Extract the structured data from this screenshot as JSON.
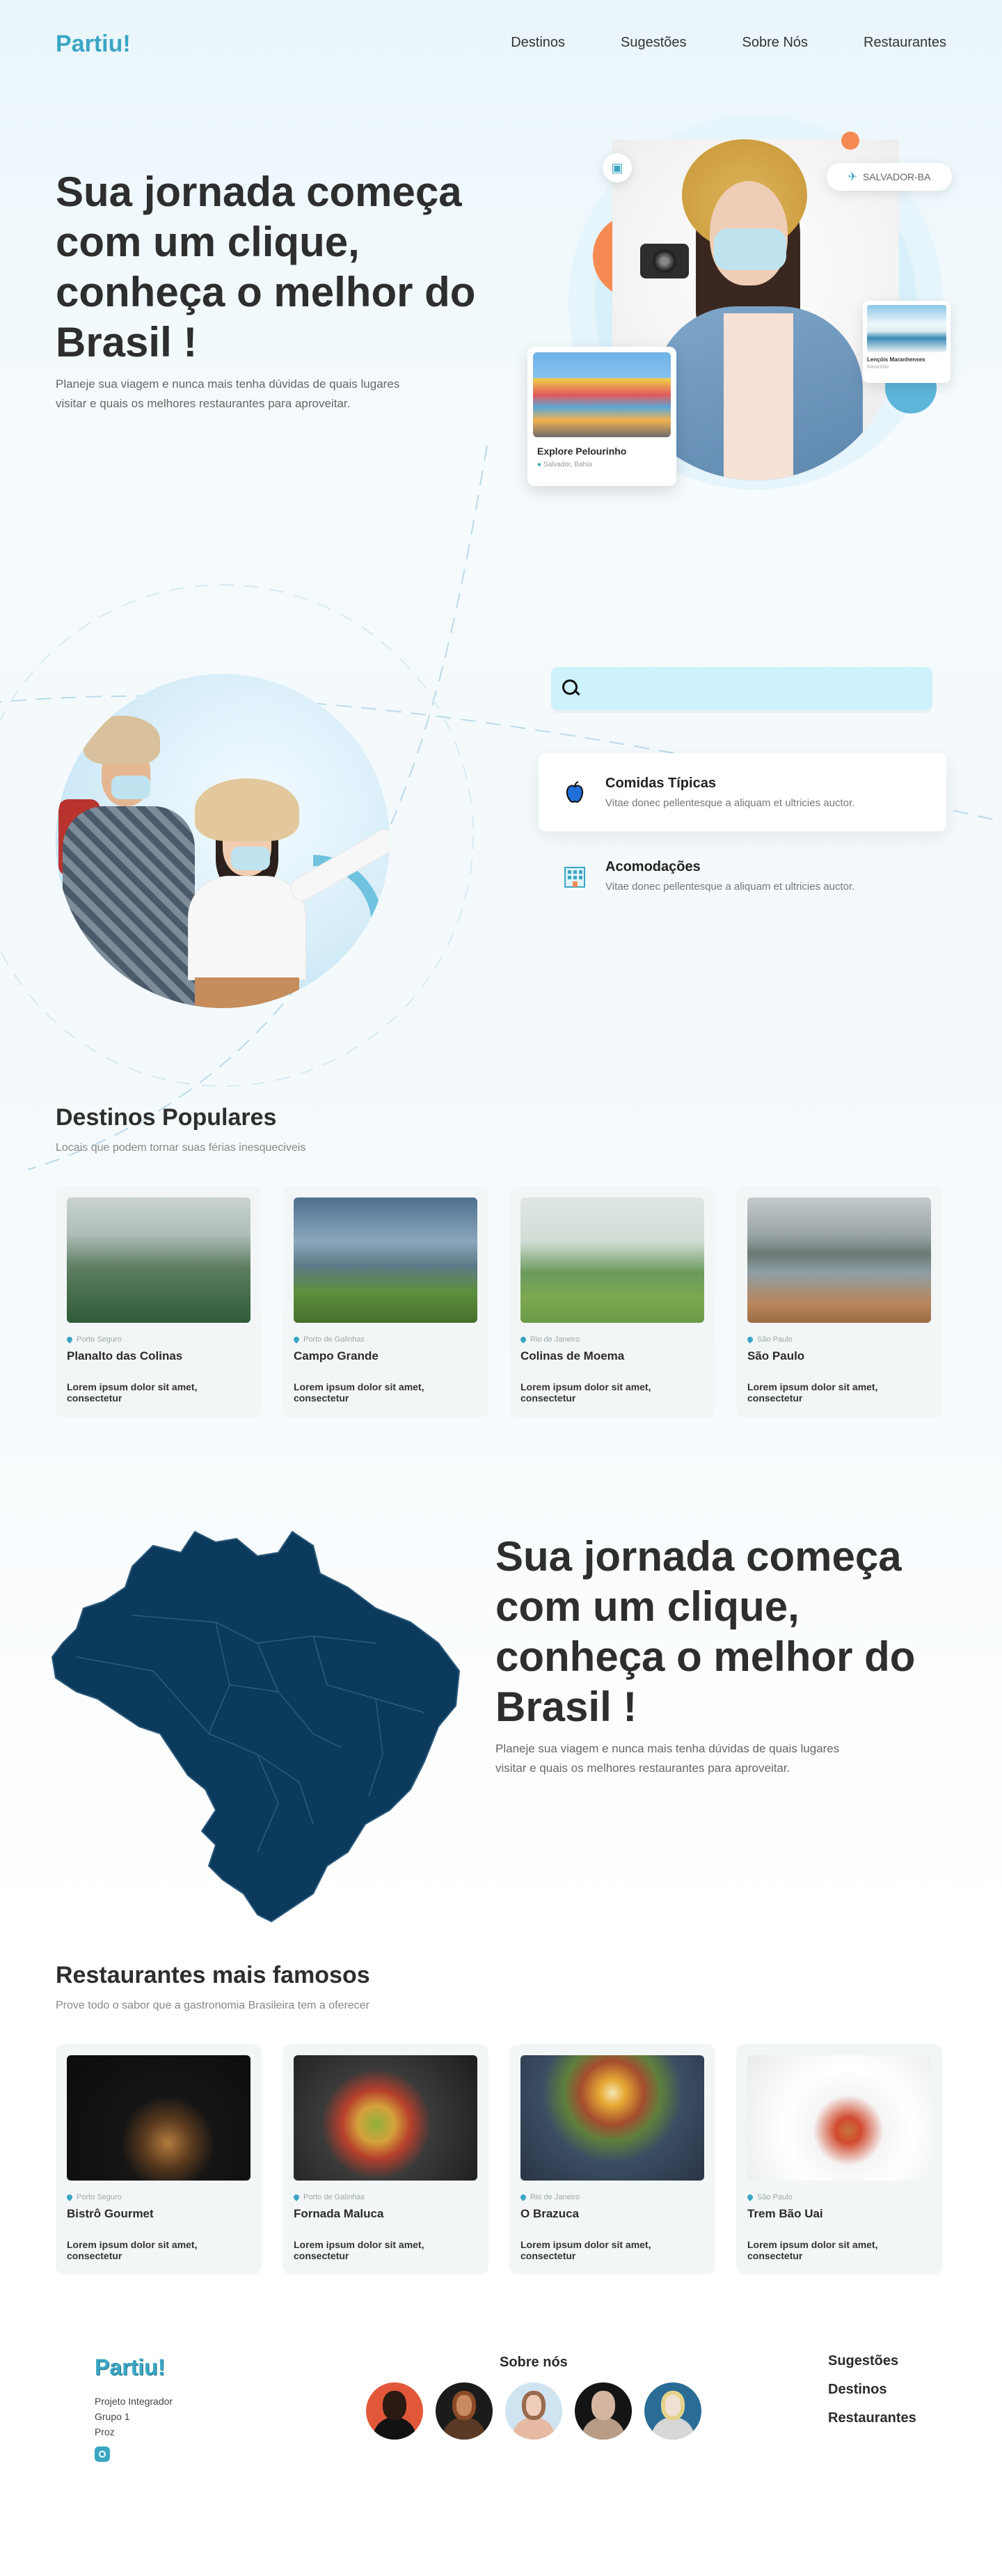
{
  "brand": {
    "logo": "Partiu!",
    "accent": "#3aa6c4",
    "orange": "#f58b52"
  },
  "nav": {
    "items": [
      {
        "label": "Destinos"
      },
      {
        "label": "Sugestões"
      },
      {
        "label": "Sobre Nós"
      },
      {
        "label": "Restaurantes"
      }
    ]
  },
  "hero": {
    "title": "Sua jornada começa com um clique, conheça o melhor do Brasil !",
    "subtitle": "Planeje sua viagem e nunca mais tenha dúvidas de quais lugares visitar e quais os melhores restaurantes para aproveitar.",
    "location_pill": "SALVADOR-BA",
    "card_pelourinho": {
      "title": "Explore Pelourinho",
      "location": "Salvador, Bahia"
    },
    "card_lencois": {
      "title": "Lençóis Maranhenses",
      "location": "Maranhão"
    }
  },
  "search": {
    "placeholder": "",
    "value": ""
  },
  "features": [
    {
      "icon": "apple-icon",
      "title": "Comidas Típicas",
      "desc": "Vitae donec pellentesque a aliquam et ultricies auctor."
    },
    {
      "icon": "hotel-icon",
      "title": "Acomodações",
      "desc": "Vitae donec pellentesque a aliquam et ultricies auctor."
    }
  ],
  "destinos": {
    "title": "Destinos Populares",
    "subtitle": "Locais que podem tornar suas férias inesqueciveis",
    "cards": [
      {
        "city": "Porto Seguro",
        "name": "Planalto das Colinas",
        "desc": "Lorem ipsum dolor sit amet, consectetur"
      },
      {
        "city": "Porto de Galinhas",
        "name": "Campo Grande",
        "desc": "Lorem ipsum dolor sit amet, consectetur"
      },
      {
        "city": "Rio de Janeiro",
        "name": "Colinas de Moema",
        "desc": "Lorem ipsum dolor sit amet, consectetur"
      },
      {
        "city": "São Paulo",
        "name": "São Paulo",
        "desc": "Lorem ipsum dolor sit amet, consectetur"
      }
    ]
  },
  "map_section": {
    "title": "Sua jornada começa com um clique, conheça o melhor do Brasil !",
    "subtitle": "Planeje sua viagem e nunca mais tenha dúvidas de quais lugares visitar e quais os melhores restaurantes para aproveitar.",
    "map_color": "#0c3a5c"
  },
  "restaurantes": {
    "title": "Restaurantes mais famosos",
    "subtitle": "Prove todo o sabor que a gastronomia Brasileira tem a oferecer",
    "cards": [
      {
        "city": "Porto Seguro",
        "name": "Bistrô Gourmet",
        "desc": "Lorem ipsum dolor sit amet, consectetur"
      },
      {
        "city": "Porto de Galinhas",
        "name": "Fornada Maluca",
        "desc": "Lorem ipsum dolor sit amet, consectetur"
      },
      {
        "city": "Rio de Janeiro",
        "name": "O Brazuca",
        "desc": "Lorem ipsum dolor sit amet, consectetur"
      },
      {
        "city": "São Paulo",
        "name": "Trem Bão Uai",
        "desc": "Lorem ipsum dolor sit amet, consectetur"
      }
    ]
  },
  "footer": {
    "logo": "Partiu!",
    "info_line1": "Projeto Integrador",
    "info_line2": "Grupo 1",
    "info_line3": "Proz",
    "about_title": "Sobre nós",
    "links": [
      {
        "label": "Sugestões"
      },
      {
        "label": "Destinos"
      },
      {
        "label": "Restaurantes"
      }
    ]
  }
}
